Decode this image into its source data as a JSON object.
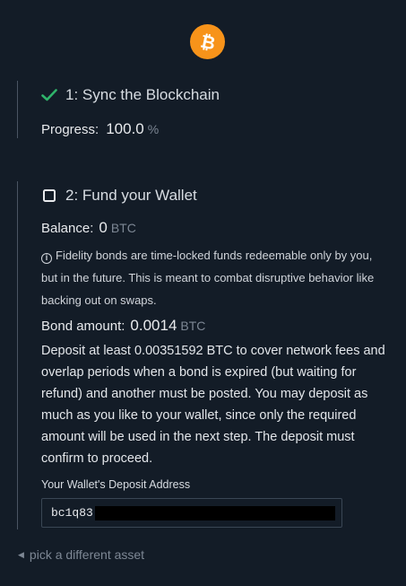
{
  "logo": {
    "icon": "bitcoin-icon",
    "color": "#f7931a",
    "glyph": "₿"
  },
  "step1": {
    "title": "1: Sync the Blockchain",
    "status_icon": "checkmark-icon",
    "status_color": "#2fb36a",
    "progress_label": "Progress:",
    "progress_value": "100.0",
    "progress_unit": "%"
  },
  "step2": {
    "title": "2: Fund your Wallet",
    "status_icon": "checkbox-empty-icon",
    "balance_label": "Balance:",
    "balance_value": "0",
    "balance_unit": "BTC",
    "info_text": "Fidelity bonds are time-locked funds redeemable only by you, but in the future. This is meant to combat disruptive behavior like backing out on swaps.",
    "bond_label": "Bond amount:",
    "bond_value": "0.0014",
    "bond_unit": "BTC",
    "deposit_text": "Deposit at least 0.00351592 BTC to cover network fees and overlap periods when a bond is expired (but waiting for refund) and another must be posted. You may deposit as much as you like to your wallet, since only the required amount will be used in the next step. The deposit must confirm to proceed.",
    "address_label": "Your Wallet's Deposit Address",
    "address_prefix": "bc1q83"
  },
  "back_link": {
    "label": "pick a different asset"
  }
}
